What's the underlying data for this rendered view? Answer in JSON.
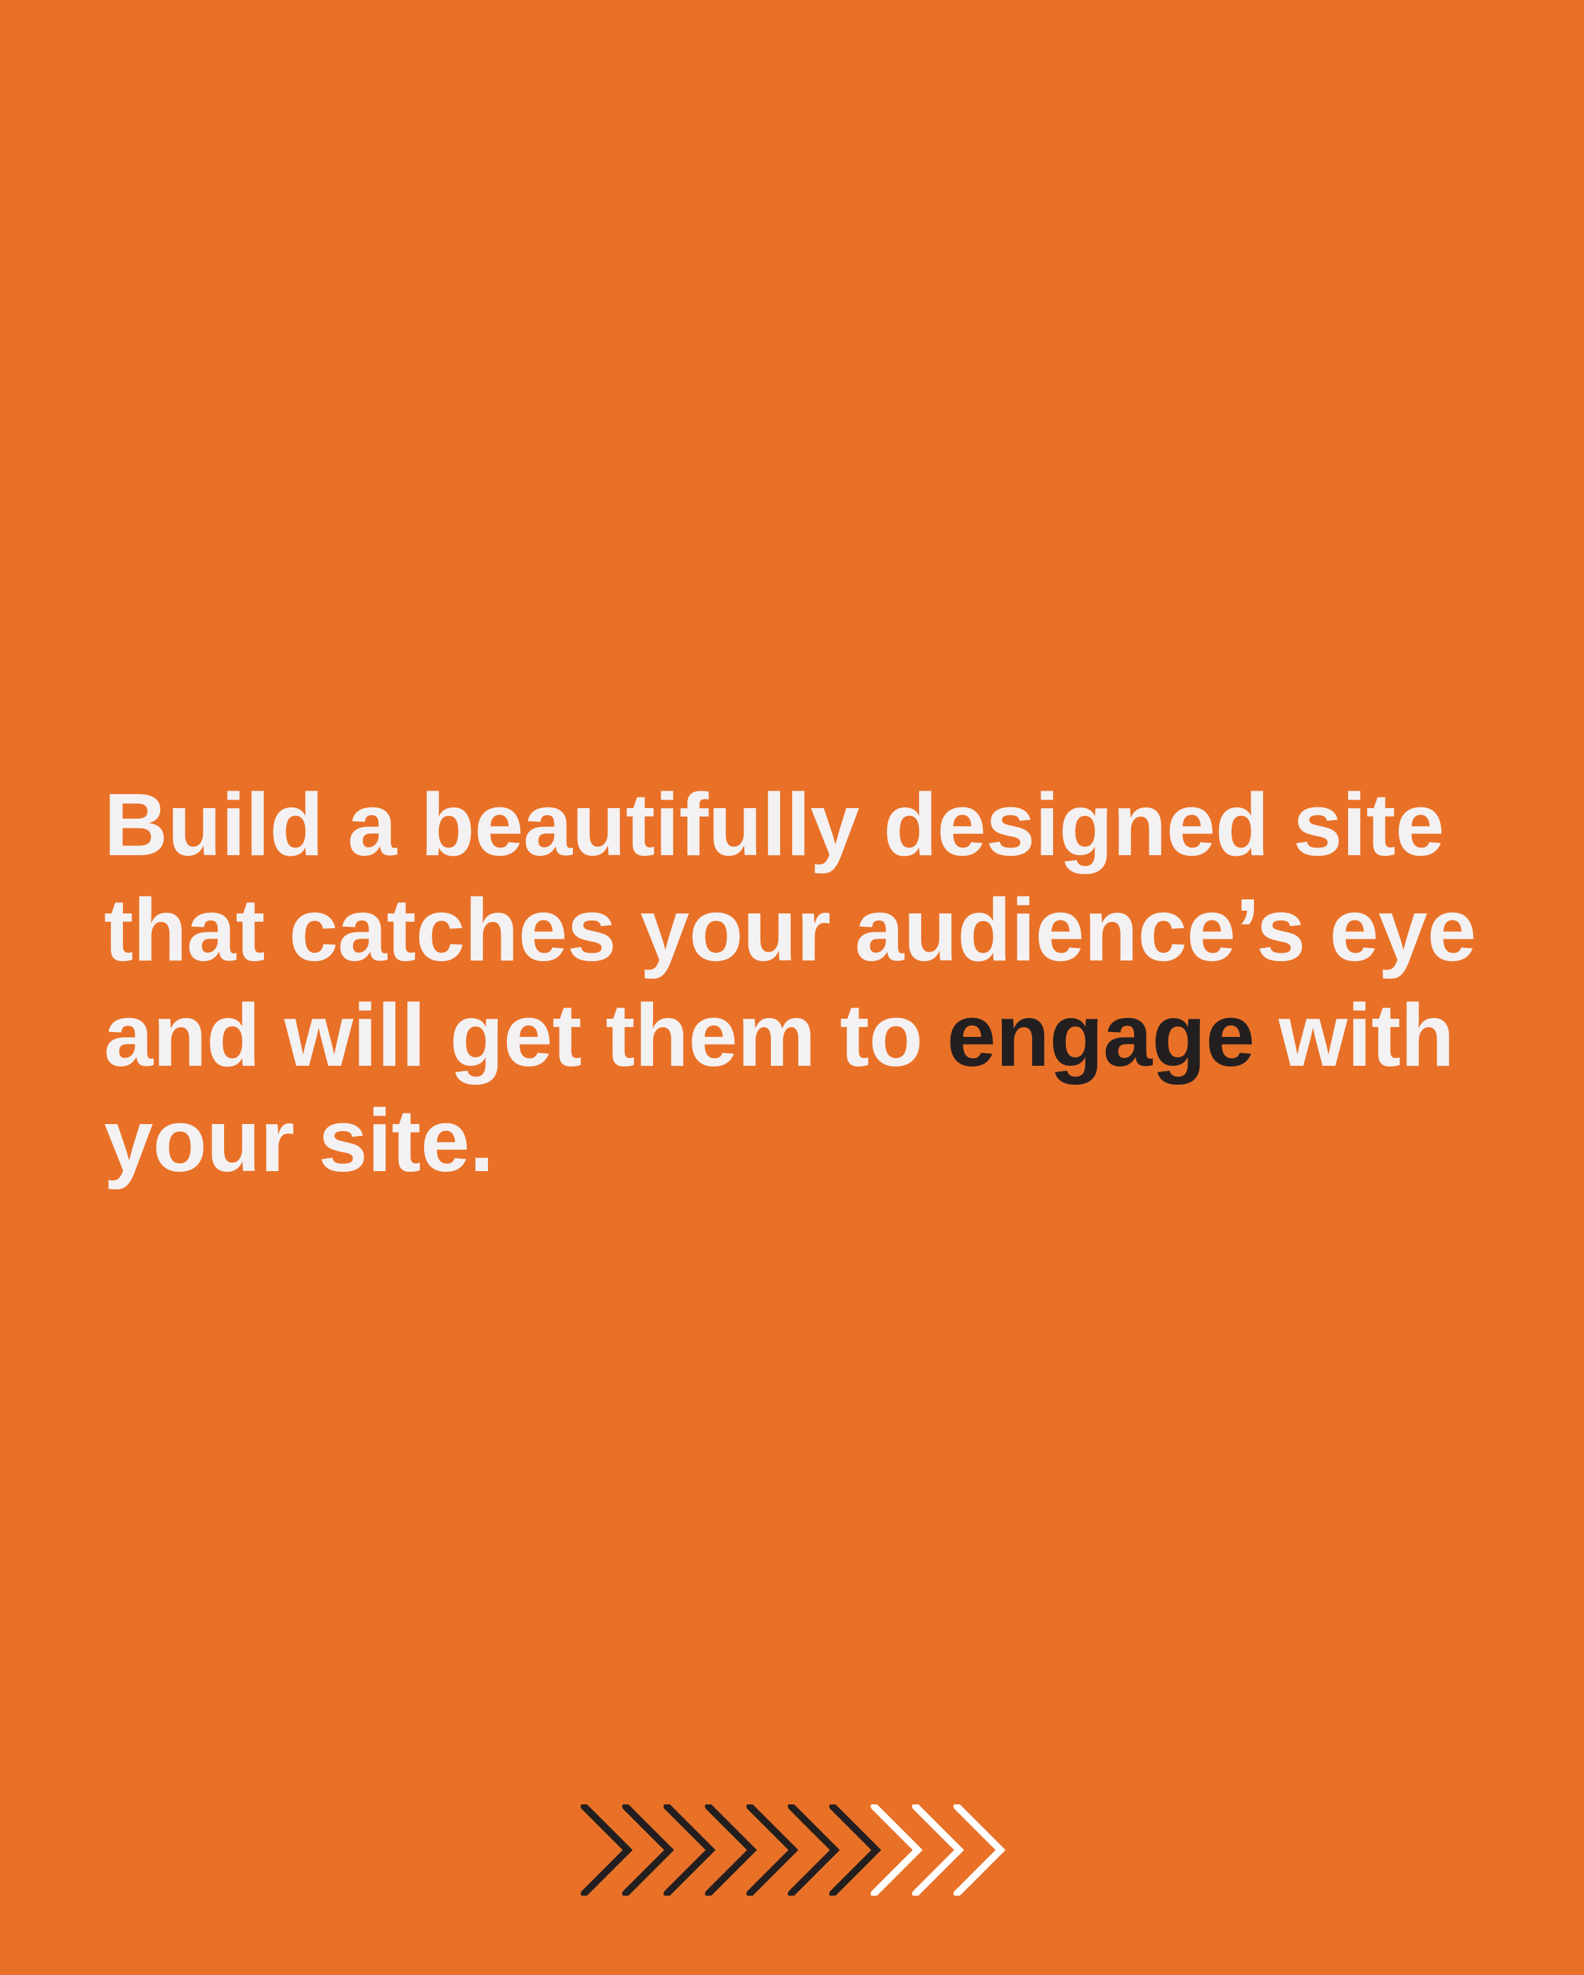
{
  "colors": {
    "background": "#E97127",
    "text": "#F4F1F3",
    "highlight": "#231F20",
    "arrow_dark": "#231F20",
    "arrow_light": "#FFFFFF"
  },
  "headline": {
    "line1": "Build a beautifully designed site",
    "line2": "that catches your audience’s eye",
    "line3_before": "and will get them to ",
    "line3_highlight": "engage",
    "line3_after": " with",
    "line4": "your site."
  },
  "arrows": {
    "icon": "chevron-right-icon",
    "colors": [
      "dark",
      "dark",
      "dark",
      "dark",
      "dark",
      "dark",
      "dark",
      "light",
      "light",
      "light"
    ]
  }
}
